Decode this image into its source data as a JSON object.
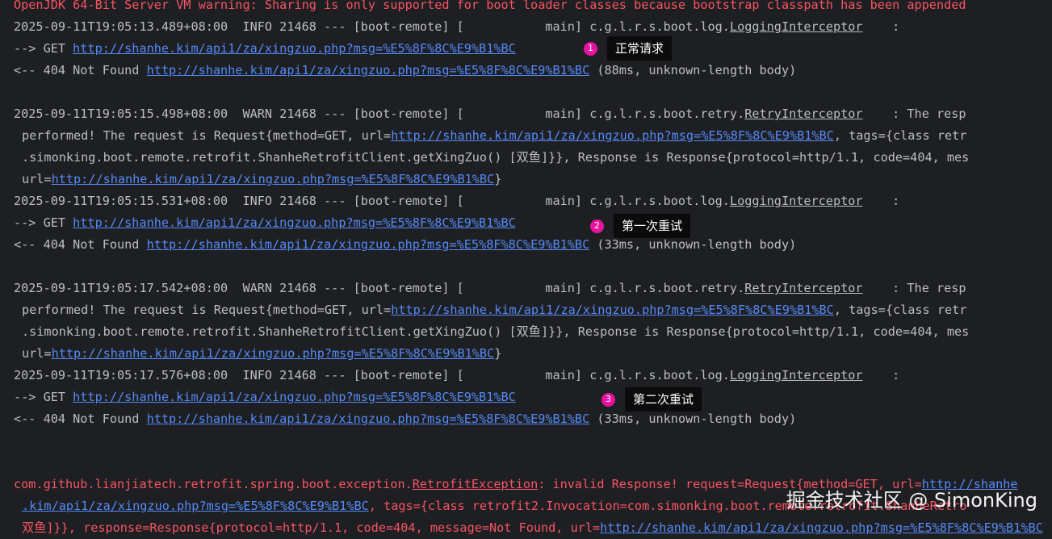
{
  "console": {
    "jvm_warning": "OpenJDK 64-Bit Server VM warning: Sharing is only supported for boot loader classes because bootstrap classpath has been appended",
    "blocks": [
      {
        "info_prefix": "2025-09-11T19:05:13.489+08:00  INFO 21468 --- [boot-remote] [           main] c.g.l.r.s.boot.log.",
        "info_class": "LoggingInterceptor",
        "info_suffix": "    :",
        "get_prefix": "--> GET ",
        "url": "http://shanhe.kim/api1/za/xingzuo.php?msg=%E5%8F%8C%E9%B1%BC",
        "resp_prefix": "<-- 404 Not Found ",
        "resp_suffix": " (88ms, unknown-length body)"
      },
      {
        "warn_prefix": "2025-09-11T19:05:15.498+08:00  WARN 21468 --- [boot-remote] [           main] c.g.l.r.s.boot.retry.",
        "warn_class": "RetryInterceptor",
        "warn_suffix": "    : The resp",
        "performed_prefix": "performed! The request is Request{method=GET, url=",
        "performed_suffix": ", tags={class retr",
        "client_line": ".simonking.boot.remote.retrofit.ShanheRetrofitClient.getXingZuo() [双鱼]}}, Response is Response{protocol=http/1.1, code=404, mes",
        "url_prefix": "url=",
        "url_suffix": "}",
        "info_prefix": "2025-09-11T19:05:15.531+08:00  INFO 21468 --- [boot-remote] [           main] c.g.l.r.s.boot.log.",
        "info_class": "LoggingInterceptor",
        "info_suffix": "    :",
        "get_prefix": "--> GET ",
        "url": "http://shanhe.kim/api1/za/xingzuo.php?msg=%E5%8F%8C%E9%B1%BC",
        "resp_prefix": "<-- 404 Not Found ",
        "resp_suffix": " (33ms, unknown-length body)"
      },
      {
        "warn_prefix": "2025-09-11T19:05:17.542+08:00  WARN 21468 --- [boot-remote] [           main] c.g.l.r.s.boot.retry.",
        "warn_class": "RetryInterceptor",
        "warn_suffix": "    : The resp",
        "performed_prefix": "performed! The request is Request{method=GET, url=",
        "performed_suffix": ", tags={class retr",
        "client_line": ".simonking.boot.remote.retrofit.ShanheRetrofitClient.getXingZuo() [双鱼]}}, Response is Response{protocol=http/1.1, code=404, mes",
        "url_prefix": "url=",
        "url_suffix": "}",
        "info_prefix": "2025-09-11T19:05:17.576+08:00  INFO 21468 --- [boot-remote] [           main] c.g.l.r.s.boot.log.",
        "info_class": "LoggingInterceptor",
        "info_suffix": "    :",
        "get_prefix": "--> GET ",
        "url": "http://shanhe.kim/api1/za/xingzuo.php?msg=%E5%8F%8C%E9%B1%BC",
        "resp_prefix": "<-- 404 Not Found ",
        "resp_suffix": " (33ms, unknown-length body)"
      }
    ],
    "exception": {
      "line1_prefix": "com.github.lianjiatech.retrofit.spring.boot.exception.",
      "line1_class": "RetrofitException",
      "line1_mid": ": invalid Response! request=Request{method=GET, url=",
      "line1_link": "http://shanhe",
      "line2_link": ".kim/api1/za/xingzuo.php?msg=%E5%8F%8C%E9%B1%BC",
      "line2_suffix": ", tags={class retrofit2.Invocation=com.simonking.boot.remote.retrofit.ShanheRetro",
      "line3_prefix": "双鱼]}}, response=Response{protocol=http/1.1, code=404, message=Not Found, url=",
      "line3_link": "http://shanhe.kim/api1/za/xingzuo.php?msg=%E5%8F%8C%E9%B1%BC"
    }
  },
  "annotations": [
    {
      "number": "1",
      "label": "正常请求"
    },
    {
      "number": "2",
      "label": "第一次重试"
    },
    {
      "number": "3",
      "label": "第二次重试"
    }
  ],
  "watermark": "掘金技术社区 @ SimonKing",
  "colors": {
    "background": "#1e1f22",
    "text": "#bcbec4",
    "warning_red": "#f75464",
    "link_blue": "#548af7",
    "badge_magenta": "#e6139e"
  }
}
